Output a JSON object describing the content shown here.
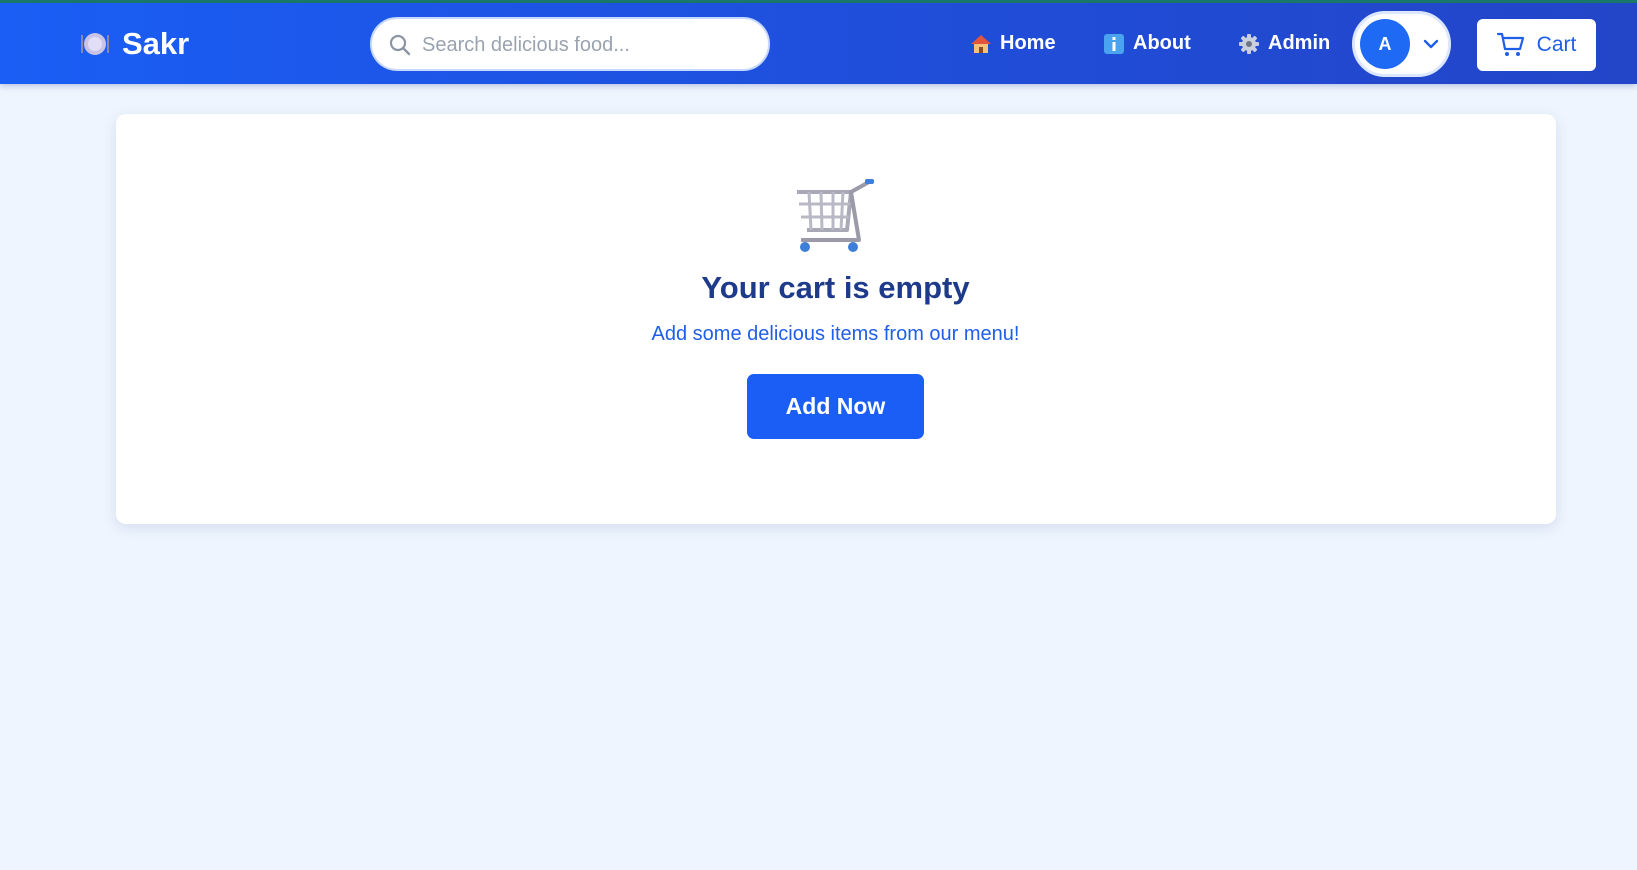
{
  "header": {
    "brand": "Sakr",
    "brand_icon": "plate-cutlery-icon",
    "search_placeholder": "Search delicious food...",
    "nav": {
      "home": "Home",
      "about": "About",
      "admin": "Admin"
    },
    "avatar_initial": "A",
    "cart_label": "Cart"
  },
  "main": {
    "empty_icon": "shopping-cart-icon",
    "title": "Your cart is empty",
    "subtitle": "Add some delicious items from our menu!",
    "cta_label": "Add Now"
  },
  "colors": {
    "primary": "#1a5ef5",
    "heading": "#1e3a8a",
    "background": "#eef5fe"
  }
}
